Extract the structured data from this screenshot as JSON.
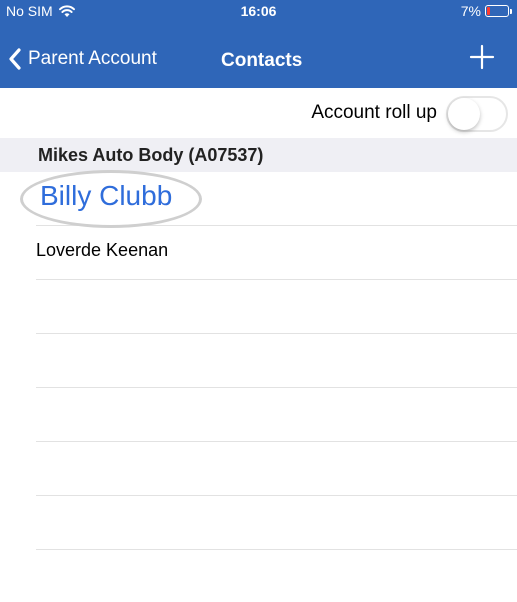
{
  "status_bar": {
    "carrier": "No SIM",
    "time": "16:06",
    "battery": "7%",
    "battery_level": 0.07,
    "wifi_icon": "wifi-icon"
  },
  "nav": {
    "back_label": "Parent Account",
    "back_icon": "chevron-left-icon",
    "title": "Contacts",
    "add_icon": "plus-icon"
  },
  "rollup": {
    "label": "Account roll up",
    "enabled": false
  },
  "section": {
    "title": "Mikes Auto Body (A07537)"
  },
  "contacts": [
    {
      "name": "Billy Clubb",
      "highlighted": true
    },
    {
      "name": "Loverde Keenan",
      "highlighted": false
    }
  ],
  "colors": {
    "header_bg": "#2f66b8",
    "link_blue": "#2f6ddb",
    "battery_low": "#ff3b30",
    "section_bg": "#efeff4"
  }
}
